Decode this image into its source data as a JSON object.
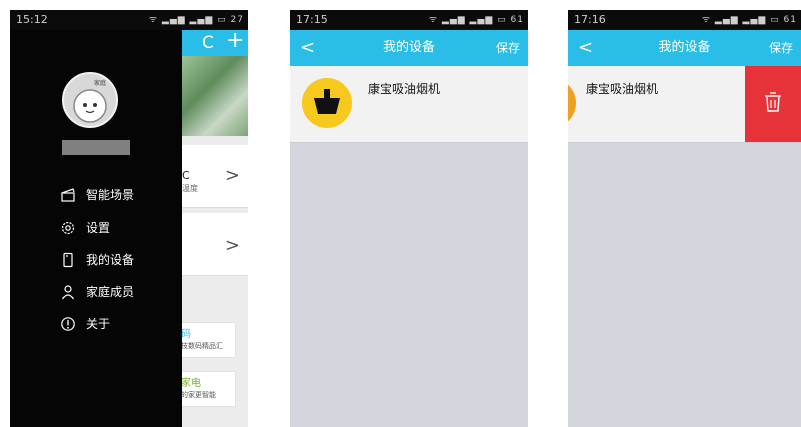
{
  "phone1": {
    "status_time": "15:12",
    "status_right": "ᯤ ▂▄▆ ▂▄▆ ▭ 27",
    "topbar_icons": [
      "refresh-icon",
      "plus-icon"
    ],
    "refresh_glyph": "C",
    "plus_glyph": "+",
    "avatar_text": "家庭",
    "menu": [
      {
        "label": "智能场景",
        "icon": "clapper-icon"
      },
      {
        "label": "设置",
        "icon": "gear-icon"
      },
      {
        "label": "我的设备",
        "icon": "device-icon"
      },
      {
        "label": "家庭成员",
        "icon": "person-icon"
      },
      {
        "label": "关于",
        "icon": "info-icon"
      }
    ],
    "row1_text": "C",
    "row1_sub": "温度",
    "chevron": ">",
    "card1_title": "码",
    "card1_sub": "技数码精品汇",
    "card2_title": "家电",
    "card2_sub": "的家更智能",
    "accent": "#29bde8",
    "card2_color": "#7bb02a"
  },
  "phone2": {
    "status_time": "17:15",
    "status_right": "ᯤ ▂▄▆ ▂▄▆ ▭ 61",
    "title": "我的设备",
    "back": "<",
    "save": "保存",
    "device_name": "康宝吸油烟机"
  },
  "phone3": {
    "status_time": "17:16",
    "status_right": "ᯤ ▂▄▆ ▂▄▆ ▭ 61",
    "title": "我的设备",
    "back": "<",
    "save": "保存",
    "device_name": "康宝吸油烟机",
    "delete_icon": "trash-icon",
    "delete_color": "#e8323a"
  }
}
